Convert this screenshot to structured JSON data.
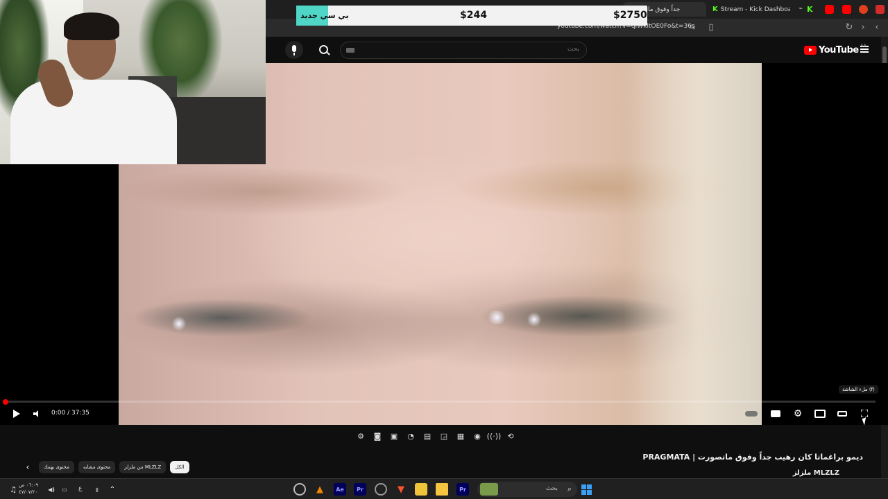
{
  "browser": {
    "tabs": [
      {
        "label": "جداً وفوق ماتصو",
        "active": true
      },
      {
        "label": "Stream - Kick Dashboard",
        "active": false
      }
    ],
    "url": "youtube.com/watch?v=qIWkItOE0Fo&t=36s"
  },
  "price_overlay": {
    "promo": "بي سي جديد",
    "price_low": "$244",
    "price_high": "$2750",
    "accent": "#4fd6c6"
  },
  "youtube": {
    "logo_text": "YouTube",
    "region": "SA",
    "search_placeholder": "بحث",
    "brand_color": "#ff0000"
  },
  "player": {
    "time": "0:00 / 37:35",
    "progress": 0.0,
    "fullscreen_tooltip": "ملء الشاشة (f)"
  },
  "video": {
    "title": "ديمو براغماتا كان رهيب جداً وفوق ماتصورت | PRAGMATA",
    "channel": "ملزلز MLZLZ"
  },
  "chips": [
    {
      "label": "الكل",
      "selected": true
    },
    {
      "label": "من ملزلز MLZLZ",
      "selected": false
    },
    {
      "label": "محتوى مشابه",
      "selected": false
    },
    {
      "label": "محتوى يهمك",
      "selected": false
    }
  ],
  "taskbar": {
    "search_label": "بحث",
    "clock_time": "٠٦:٠٩ ص",
    "clock_date": "٤٧/٠٧/٢٠",
    "lang": "ع"
  }
}
